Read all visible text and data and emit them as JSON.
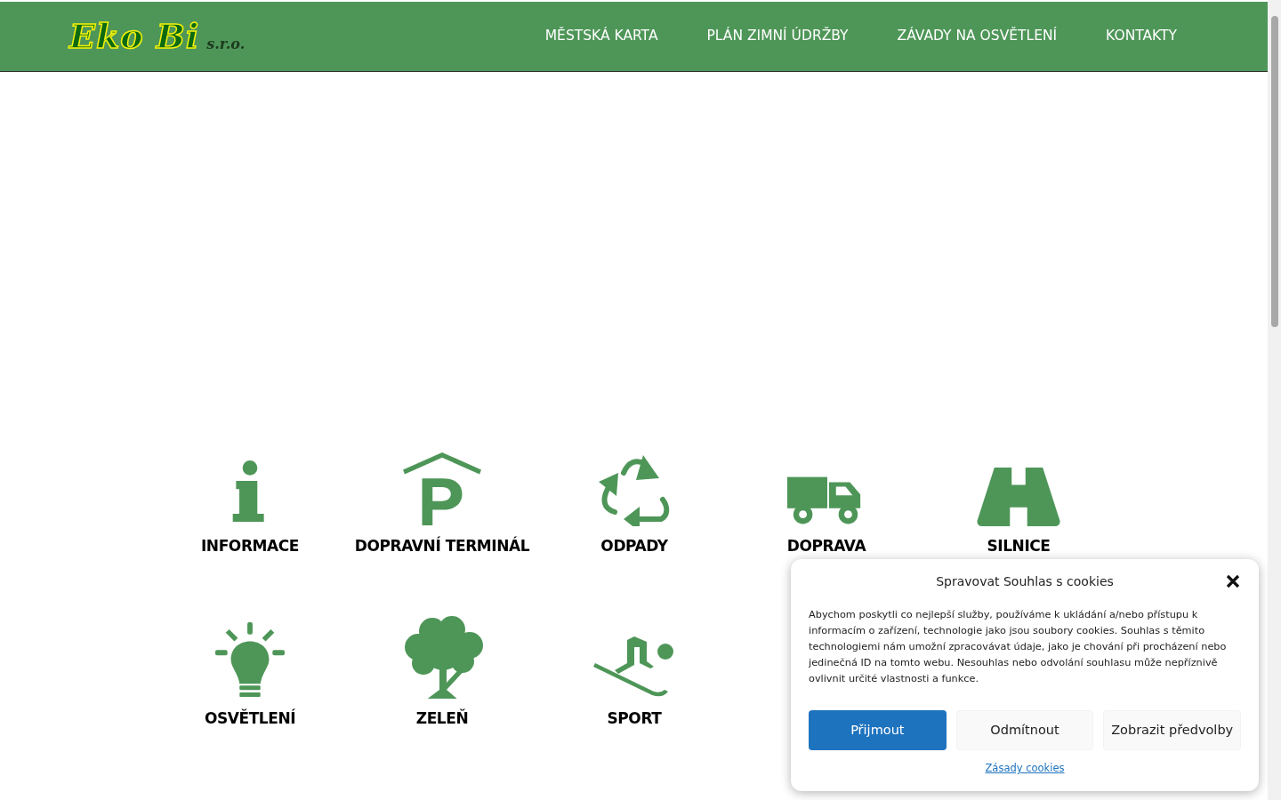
{
  "header": {
    "logo": {
      "name": "Eko Bi",
      "suffix": "s.r.o."
    },
    "nav": [
      "MĚSTSKÁ KARTA",
      "PLÁN ZIMNÍ ÚDRŽBY",
      "ZÁVADY NA OSVĚTLENÍ",
      "KONTAKTY"
    ]
  },
  "tiles": [
    {
      "kind": "info",
      "label": "INFORMACE"
    },
    {
      "kind": "parking",
      "label": "DOPRAVNÍ TERMINÁL"
    },
    {
      "kind": "recycle",
      "label": "ODPADY"
    },
    {
      "kind": "truck",
      "label": "DOPRAVA"
    },
    {
      "kind": "road",
      "label": "SILNICE"
    },
    {
      "kind": "bulb",
      "label": "OSVĚTLENÍ"
    },
    {
      "kind": "tree",
      "label": "ZELEŇ"
    },
    {
      "kind": "skier",
      "label": "SPORT"
    }
  ],
  "cookie_dialog": {
    "title": "Spravovat Souhlas s cookies",
    "text": "Abychom poskytli co nejlepší služby, používáme k ukládání a/nebo přístupu k informacím o zařízení, technologie jako jsou soubory cookies. Souhlas s těmito technologiemi nám umožní zpracovávat údaje, jako je chování při procházení nebo jedinečná ID na tomto webu. Nesouhlas nebo odvolání souhlasu může nepříznivě ovlivnit určité vlastnosti a funkce.",
    "buttons": [
      {
        "label": "Přijmout",
        "primary": true
      },
      {
        "label": "Odmítnout",
        "primary": false
      },
      {
        "label": "Zobrazit předvolby",
        "primary": false
      }
    ],
    "link": "Zásady cookies"
  }
}
